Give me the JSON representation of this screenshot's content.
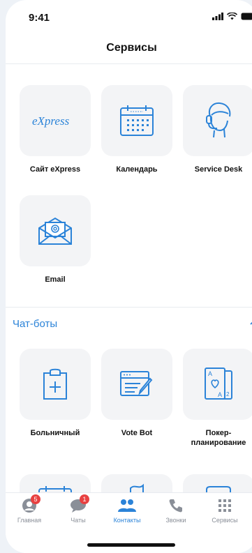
{
  "status": {
    "time": "9:41"
  },
  "header": {
    "title": "Сервисы"
  },
  "services": [
    {
      "label": "Сайт eXpress",
      "icon": "express-logo-icon"
    },
    {
      "label": "Календарь",
      "icon": "calendar-icon"
    },
    {
      "label": "Service Desk",
      "icon": "support-agent-icon"
    },
    {
      "label": "Email",
      "icon": "email-icon"
    }
  ],
  "chatbots": {
    "title": "Чат-боты",
    "items": [
      {
        "label": "Больничный",
        "icon": "clipboard-plus-icon"
      },
      {
        "label": "Vote Bot",
        "icon": "vote-edit-icon"
      },
      {
        "label": "Покер-\nпланирование",
        "icon": "poker-cards-icon"
      }
    ]
  },
  "logo_text": "eXpress",
  "tabbar": [
    {
      "label": "Главная",
      "badge": "5",
      "icon": "profile-icon"
    },
    {
      "label": "Чаты",
      "badge": "1",
      "icon": "chat-bubble-icon"
    },
    {
      "label": "Контакты",
      "badge": "",
      "icon": "contacts-icon",
      "active": true
    },
    {
      "label": "Звонки",
      "badge": "",
      "icon": "phone-icon"
    },
    {
      "label": "Сервисы",
      "badge": "",
      "icon": "grid-icon"
    }
  ],
  "colors": {
    "accent": "#2b83d8",
    "badge": "#e84141",
    "tile": "#f3f4f6"
  }
}
